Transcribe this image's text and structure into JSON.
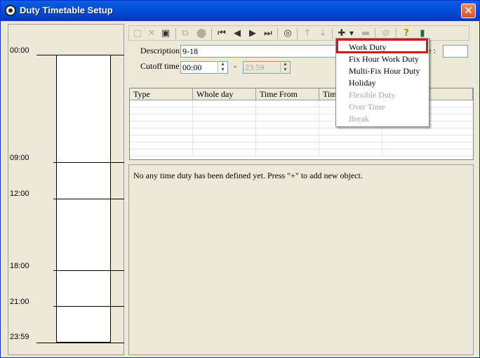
{
  "window": {
    "title": "Duty Timetable Setup",
    "close_glyph": "✕"
  },
  "timeline": {
    "labels": [
      "00:00",
      "09:00",
      "12:00",
      "18:00",
      "21:00",
      "23:59"
    ]
  },
  "toolbar": {
    "icons": [
      "new-icon",
      "delete-icon",
      "save-icon",
      "copy-icon",
      "record-icon",
      "first-icon",
      "prev-icon",
      "next-icon",
      "last-icon",
      "find-icon",
      "up-icon",
      "down-icon",
      "add-icon",
      "dropdown-arrow-icon",
      "remove-icon",
      "disable-icon",
      "help-icon",
      "exit-icon"
    ]
  },
  "form": {
    "description_label": "Description",
    "description_value": "9-18",
    "cutoff_label": "Cutoff time",
    "cutoff_from": "00:00",
    "cutoff_dash": "-",
    "cutoff_to": "23:59",
    "hidden_label_suffix": "e :"
  },
  "grid": {
    "columns": [
      "Type",
      "Whole day",
      "Time From",
      "Time"
    ]
  },
  "message": "No any time duty has been defined yet. Press \"+\" to add new object.",
  "menu": {
    "items": [
      {
        "label": "Work Duty",
        "enabled": true
      },
      {
        "label": "Fix Hour Work Duty",
        "enabled": true
      },
      {
        "label": "Multi-Fix Hour Duty",
        "enabled": true
      },
      {
        "label": "Holiday",
        "enabled": true
      },
      {
        "label": "Flexible Duty",
        "enabled": false
      },
      {
        "label": "Over Time",
        "enabled": false
      },
      {
        "label": "Break",
        "enabled": false
      }
    ]
  },
  "colors": {
    "titlebar": "#0450d8",
    "highlight": "#e01010",
    "window_bg": "#ece9d8"
  }
}
